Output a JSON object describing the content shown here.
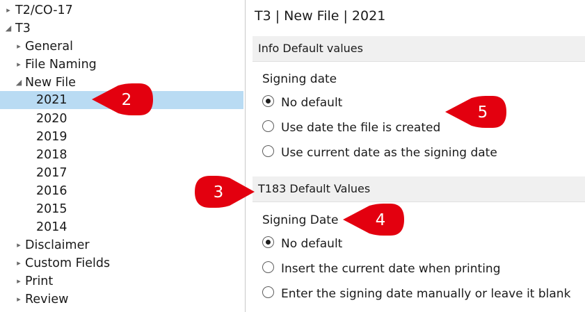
{
  "tree": {
    "items": [
      {
        "label": "T2/CO-17",
        "arrow": "▸"
      },
      {
        "label": "T3",
        "arrow": "◢"
      },
      {
        "label": "General",
        "arrow": "▸"
      },
      {
        "label": "File Naming",
        "arrow": "▸"
      },
      {
        "label": "New File",
        "arrow": "◢"
      },
      {
        "label": "2021",
        "arrow": ""
      },
      {
        "label": "2020",
        "arrow": ""
      },
      {
        "label": "2019",
        "arrow": ""
      },
      {
        "label": "2018",
        "arrow": ""
      },
      {
        "label": "2017",
        "arrow": ""
      },
      {
        "label": "2016",
        "arrow": ""
      },
      {
        "label": "2015",
        "arrow": ""
      },
      {
        "label": "2014",
        "arrow": ""
      },
      {
        "label": "Disclaimer",
        "arrow": "▸"
      },
      {
        "label": "Custom Fields",
        "arrow": "▸"
      },
      {
        "label": "Print",
        "arrow": "▸"
      },
      {
        "label": "Review",
        "arrow": "▸"
      }
    ],
    "selected": "2021"
  },
  "page_title": "T3 | New File | 2021",
  "sections": [
    {
      "header": "Info Default values",
      "group_label": "Signing date",
      "options": [
        "No default",
        "Use date the file is created",
        "Use current date as the signing date"
      ],
      "selected_option": "No default"
    },
    {
      "header": "T183 Default Values",
      "group_label": "Signing Date",
      "options": [
        "No default",
        "Insert the current date when printing",
        "Enter the signing date manually or leave it blank"
      ],
      "selected_option": "No default"
    }
  ],
  "callouts": [
    "2",
    "5",
    "3",
    "4"
  ],
  "colors": {
    "selection": "#b9dbf3",
    "callout": "#e3000f",
    "section_header_bg": "#f0f0f0"
  }
}
